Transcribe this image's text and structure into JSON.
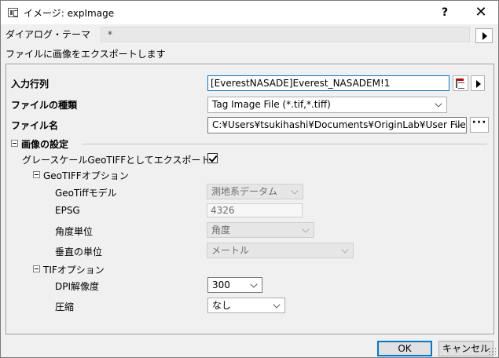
{
  "window": {
    "title": "イメージ: expImage",
    "help": "?",
    "close": "✕"
  },
  "theme": {
    "label": "ダイアログ・テーマ",
    "value": "*"
  },
  "description": "ファイルに画像をエクスポートします",
  "form": {
    "input_label": "入力行列",
    "input_value": "[EverestNASADE]Everest_NASADEM!1",
    "filetype_label": "ファイルの種類",
    "filetype_value": "Tag Image File (*.tif,*.tiff)",
    "filename_label": "ファイル名",
    "filename_value": "C:¥Users¥tsukihashi¥Documents¥OriginLab¥User Files¥Eve"
  },
  "image_settings": {
    "header": "画像の設定",
    "geotiff_export_label": "グレースケールGeoTIFFとしてエクスポート",
    "geotiff_export_checked": true,
    "geotiff_options": {
      "header": "GeoTIFFオプション",
      "model_label": "GeoTiffモデル",
      "model_value": "測地系データム",
      "epsg_label": "EPSG",
      "epsg_value": "4326",
      "angle_label": "角度単位",
      "angle_value": "角度",
      "vertical_label": "垂直の単位",
      "vertical_value": "メートル"
    },
    "tif_options": {
      "header": "TIFオプション",
      "dpi_label": "DPI解像度",
      "dpi_value": "300",
      "compress_label": "圧縮",
      "compress_value": "なし"
    }
  },
  "buttons": {
    "ok": "OK",
    "cancel": "キャンセル"
  }
}
